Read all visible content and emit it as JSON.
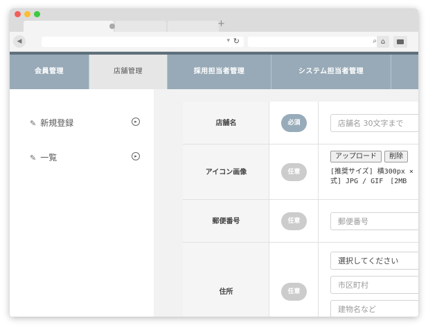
{
  "nav": {
    "items": [
      {
        "label": "会員管理"
      },
      {
        "label": "店舗管理"
      },
      {
        "label": "採用担当者管理"
      },
      {
        "label": "システム担当者管理"
      }
    ]
  },
  "sidebar": {
    "items": [
      {
        "label": "新規登録"
      },
      {
        "label": "一覧"
      }
    ]
  },
  "form": {
    "store_name": {
      "label": "店舗名",
      "badge": "必須",
      "placeholder": "店舗名 30文字まで"
    },
    "icon_image": {
      "label": "アイコン画像",
      "badge": "任意",
      "upload_label": "アップロード",
      "delete_label": "削除",
      "note_line1": "[推奨サイズ] 横300px ×",
      "note_line2": "式] JPG / GIF　[2MB"
    },
    "postal_code": {
      "label": "郵便番号",
      "badge": "任意",
      "placeholder": "郵便番号"
    },
    "address": {
      "label": "住所",
      "badge": "任意",
      "prefecture_selected": "選択してください",
      "city_placeholder": "市区町村",
      "street_placeholder": "建物名など"
    }
  },
  "colors": {
    "nav_bg": "#98aab7",
    "nav_border": "#5e6f7c",
    "badge_required": "#97abba",
    "badge_optional": "#cccccc",
    "traffic_red": "#f25f58",
    "traffic_yellow": "#fbbe2f",
    "traffic_green": "#3dc93f"
  }
}
